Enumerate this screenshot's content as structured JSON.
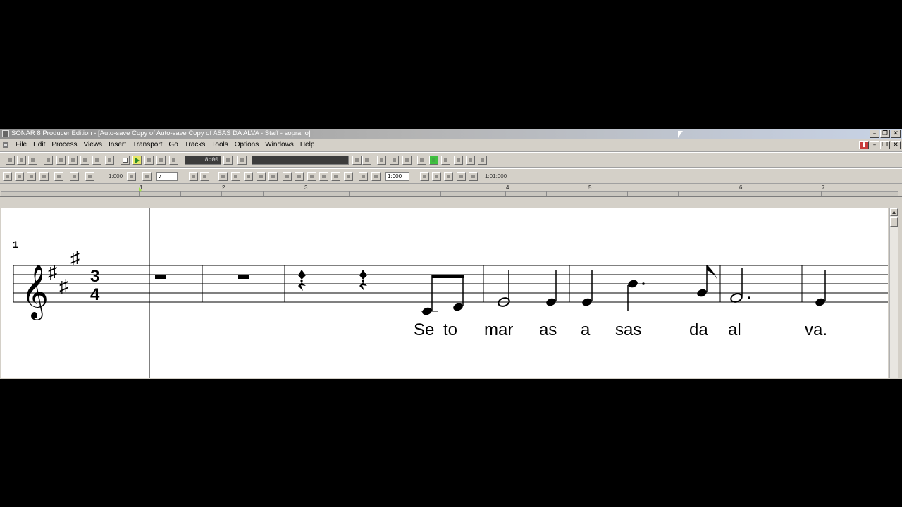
{
  "window": {
    "title": "SONAR 8 Producer Edition - [Auto-save Copy of Auto-save Copy of ASAS DA ALVA - Staff - soprano]",
    "controls": [
      "minimize-icon",
      "restore-icon",
      "close-icon"
    ]
  },
  "menu": {
    "items": [
      "File",
      "Edit",
      "Process",
      "Views",
      "Insert",
      "Transport",
      "Go",
      "Tracks",
      "Tools",
      "Options",
      "Windows",
      "Help"
    ]
  },
  "toolbar1": {
    "time_display": "8:00"
  },
  "toolbar2": {
    "snap_value": "1:000",
    "duration_value": "1:000",
    "position_value": "1:01:000"
  },
  "ruler": {
    "measures": [
      "1",
      "2",
      "3",
      "4",
      "5",
      "6",
      "7"
    ]
  },
  "staff": {
    "measure_number": "1",
    "time_signature": {
      "top": "3",
      "bottom": "4"
    },
    "key": "A major (3 sharps)",
    "clef": "treble",
    "lyrics": [
      "Se",
      "to",
      "mar",
      "as",
      "a",
      "sas",
      "da",
      "al",
      "va."
    ]
  },
  "colors": {
    "accent_play": "#e7e76a",
    "accent_green": "#3fbf3f",
    "lock_red": "#c83c3c"
  }
}
